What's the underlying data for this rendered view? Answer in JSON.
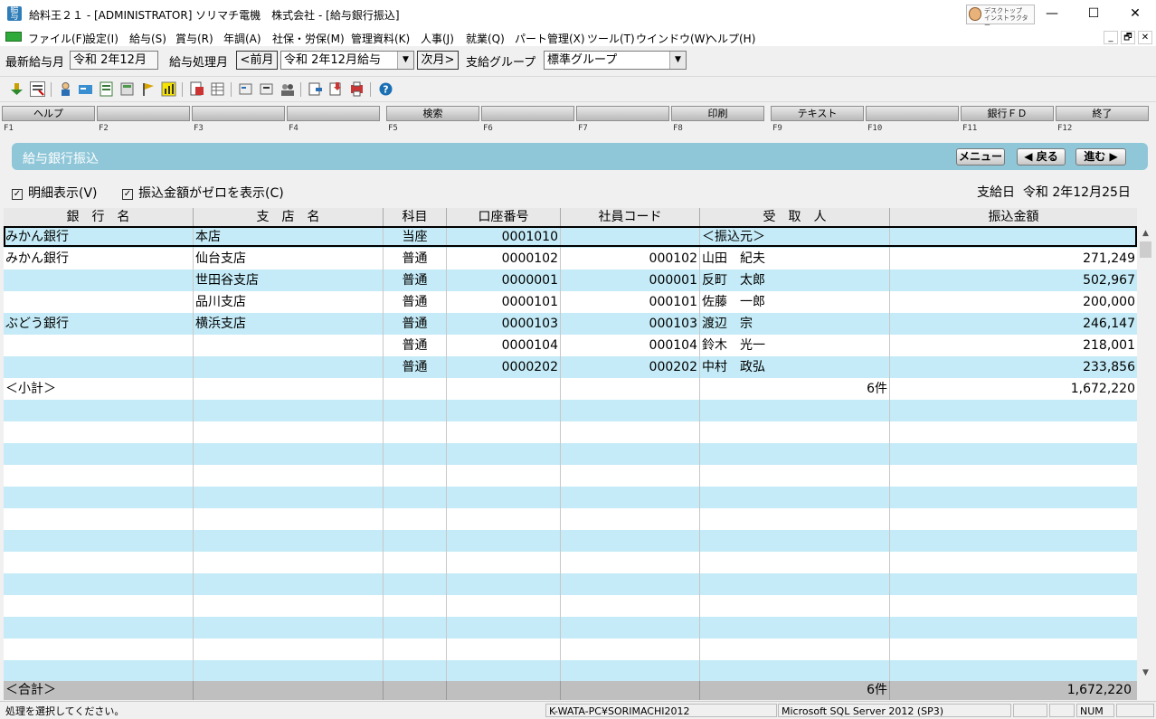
{
  "window": {
    "title": "給料王２１ - [ADMINISTRATOR] ソリマチ電機　株式会社 - [給与銀行振込]",
    "app_icon_text": "給与",
    "instructor_label": "デスクトップ\nインストラクター",
    "minimize_glyph": "—",
    "maximize_glyph": "☐",
    "close_glyph": "✕"
  },
  "menu": {
    "items": [
      "ファイル(F)",
      "設定(I)",
      "給与(S)",
      "賞与(R)",
      "年調(A)",
      "社保・労保(M)",
      "管理資料(K)",
      "人事(J)",
      "就業(Q)",
      "パート管理(X)",
      "ツール(T)",
      "ウインドウ(W)",
      "ヘルプ(H)"
    ],
    "mdi_min": "_",
    "mdi_restore": "🗗",
    "mdi_close": "✕"
  },
  "selection": {
    "latest_month_label": "最新給与月",
    "latest_month_value": "令和 2年12月",
    "process_month_label": "給与処理月",
    "prev_button": "<前月",
    "process_month_value": "令和 2年12月給与",
    "next_button": "次月>",
    "group_label": "支給グループ",
    "group_value": "標準グループ"
  },
  "function_keys": [
    {
      "label": "ヘルプ",
      "key": "F1"
    },
    {
      "label": "",
      "key": "F2"
    },
    {
      "label": "",
      "key": "F3"
    },
    {
      "label": "",
      "key": "F4"
    },
    {
      "label": "検索",
      "key": "F5"
    },
    {
      "label": "",
      "key": "F6"
    },
    {
      "label": "",
      "key": "F7"
    },
    {
      "label": "印刷",
      "key": "F8"
    },
    {
      "label": "テキスト",
      "key": "F9"
    },
    {
      "label": "",
      "key": "F10"
    },
    {
      "label": "銀行ＦＤ",
      "key": "F11"
    },
    {
      "label": "終了",
      "key": "F12"
    }
  ],
  "panel": {
    "title": "給与銀行振込",
    "menu_button": "メニュー",
    "back_button": "◀ 戻る",
    "forward_button": "進む ▶"
  },
  "options": {
    "detail_checkbox": "明細表示(V)",
    "zero_checkbox": "振込金額がゼロを表示(C)",
    "check_glyph": "✓",
    "pay_date_label": "支給日",
    "pay_date_value": "令和 2年12月25日"
  },
  "grid": {
    "columns": [
      "銀　行　名",
      "支　店　名",
      "科目",
      "口座番号",
      "社員コード",
      "受　取　人",
      "振込金額"
    ],
    "rows": [
      {
        "bank": "みかん銀行",
        "branch": "本店",
        "type": "当座",
        "account": "0001010",
        "code": "",
        "recipient": "＜振込元＞",
        "amount": ""
      },
      {
        "bank": "みかん銀行",
        "branch": "仙台支店",
        "type": "普通",
        "account": "0000102",
        "code": "000102",
        "recipient": "山田　紀夫",
        "amount": "271,249"
      },
      {
        "bank": "",
        "branch": "世田谷支店",
        "type": "普通",
        "account": "0000001",
        "code": "000001",
        "recipient": "反町　太郎",
        "amount": "502,967"
      },
      {
        "bank": "",
        "branch": "品川支店",
        "type": "普通",
        "account": "0000101",
        "code": "000101",
        "recipient": "佐藤　一郎",
        "amount": "200,000"
      },
      {
        "bank": "ぶどう銀行",
        "branch": "横浜支店",
        "type": "普通",
        "account": "0000103",
        "code": "000103",
        "recipient": "渡辺　宗",
        "amount": "246,147"
      },
      {
        "bank": "",
        "branch": "",
        "type": "普通",
        "account": "0000104",
        "code": "000104",
        "recipient": "鈴木　光一",
        "amount": "218,001"
      },
      {
        "bank": "",
        "branch": "",
        "type": "普通",
        "account": "0000202",
        "code": "000202",
        "recipient": "中村　政弘",
        "amount": "233,856"
      },
      {
        "bank": "＜小計＞",
        "branch": "",
        "type": "",
        "account": "",
        "code": "",
        "recipient": "6件",
        "amount": "1,672,220"
      }
    ],
    "empty_rows": 13
  },
  "total": {
    "label": "＜合計＞",
    "count": "6件",
    "amount": "1,672,220"
  },
  "scrollbar": {
    "up": "▲",
    "down": "▼"
  },
  "status": {
    "message": "処理を選択してください。",
    "machine": "K-WATA-PC¥SORIMACHI2012",
    "server": "Microsoft SQL Server 2012 (SP3)",
    "num": "NUM"
  }
}
